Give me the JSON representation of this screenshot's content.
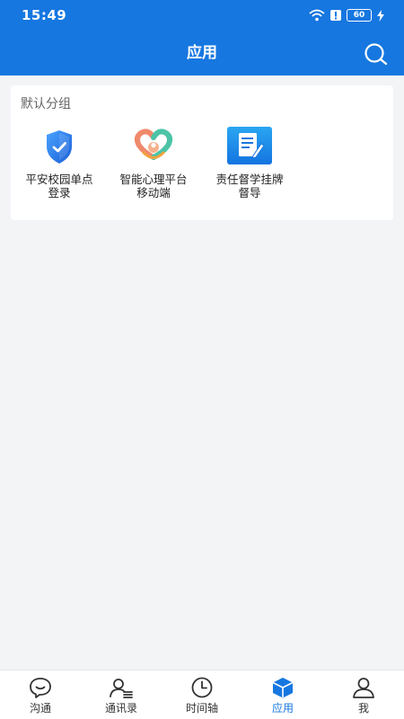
{
  "status_bar": {
    "time": "15:49",
    "battery": "60"
  },
  "header": {
    "title": "应用"
  },
  "group": {
    "title": "默认分组",
    "apps": [
      {
        "line1": "平安校园单点",
        "line2": "登录",
        "icon": "shield-check-icon"
      },
      {
        "line1": "智能心理平台",
        "line2": "移动端",
        "icon": "heart-hands-icon"
      },
      {
        "line1": "责任督学挂牌",
        "line2": "督导",
        "icon": "document-edit-icon"
      }
    ]
  },
  "tabbar": {
    "active": "应用",
    "items": [
      {
        "label": "沟通",
        "icon": "chat-bubble-icon"
      },
      {
        "label": "通讯录",
        "icon": "contacts-icon"
      },
      {
        "label": "时间轴",
        "icon": "clock-icon"
      },
      {
        "label": "应用",
        "icon": "cube-icon"
      },
      {
        "label": "我",
        "icon": "person-icon"
      }
    ]
  },
  "colors": {
    "primary": "#1677e0",
    "background": "#f3f4f6"
  }
}
